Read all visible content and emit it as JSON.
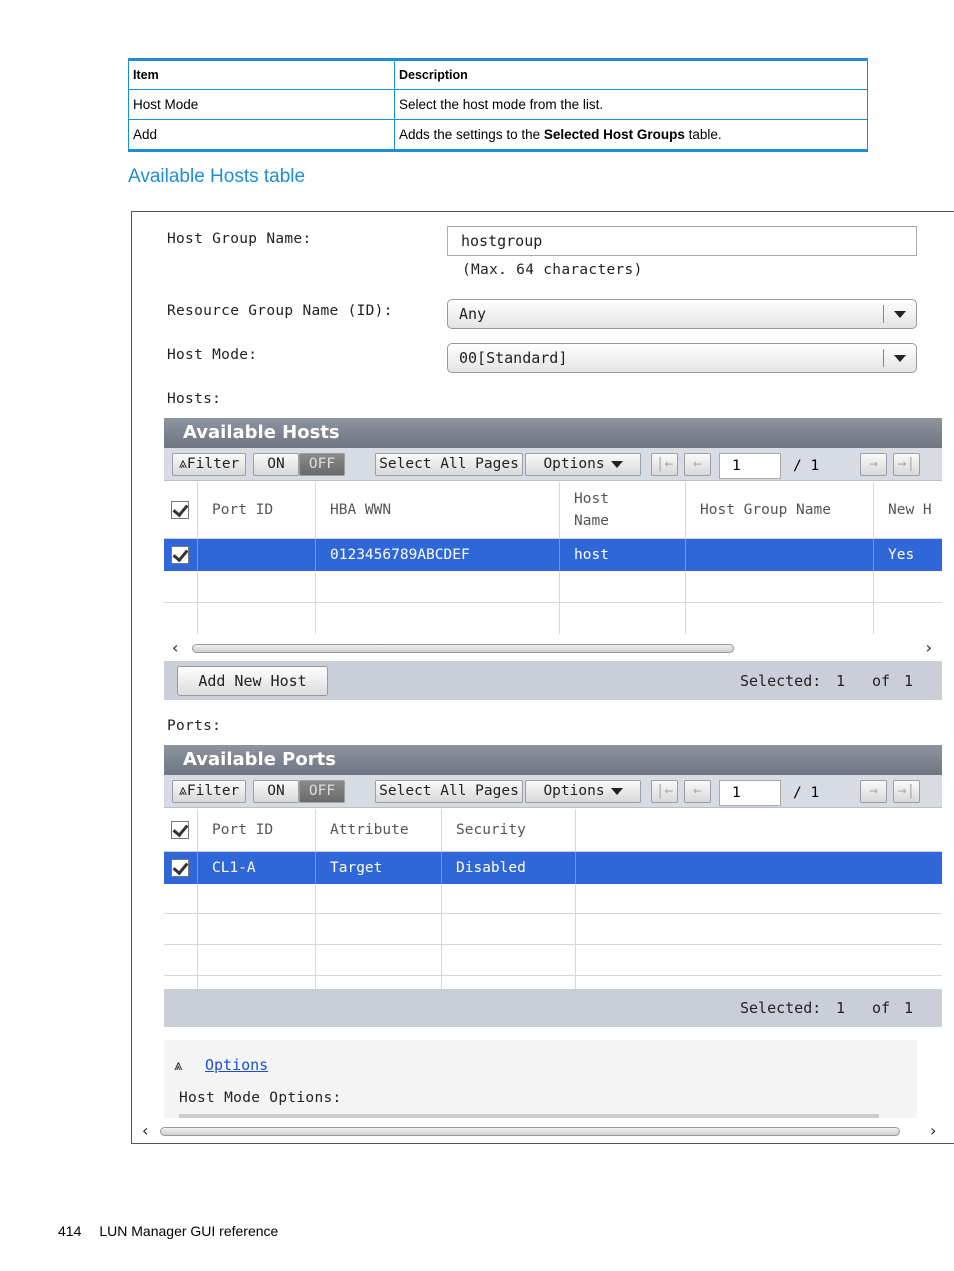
{
  "doc_table": {
    "headers": [
      "Item",
      "Description"
    ],
    "rows": [
      {
        "item": "Host Mode",
        "desc_pre": "Select the host mode from the list.",
        "desc_bold": "",
        "desc_post": ""
      },
      {
        "item": "Add",
        "desc_pre": "Adds the settings to the ",
        "desc_bold": "Selected Host Groups",
        "desc_post": " table."
      }
    ]
  },
  "section_heading": "Available Hosts table",
  "form": {
    "host_group_label": "Host Group Name:",
    "host_group_value": "hostgroup",
    "host_group_hint": "(Max. 64 characters)",
    "resource_group_label": "Resource Group Name (ID):",
    "resource_group_value": "Any",
    "host_mode_label": "Host Mode:",
    "host_mode_value": "00[Standard]",
    "hosts_label": "Hosts:",
    "ports_label": "Ports:"
  },
  "toolbar": {
    "filter": "⩓Filter",
    "on": "ON",
    "off": "OFF",
    "select_all": "Select All Pages",
    "options": "Options",
    "first": "|←",
    "prev": "←",
    "page": "1",
    "of_pages": "/ 1",
    "next": "→",
    "last": "→|"
  },
  "hosts_table": {
    "title": "Available Hosts",
    "columns": [
      "Port ID",
      "HBA WWN",
      "Host\nName",
      "Host Group Name",
      "New H"
    ],
    "col_host_name_1": "Host",
    "col_host_name_2": "Name",
    "selected_row": [
      "",
      "0123456789ABCDEF",
      "host",
      "",
      "Yes"
    ],
    "add_button": "Add New Host",
    "selected_label": "Selected:",
    "selected_count": "1",
    "of_label": "of",
    "total": "1"
  },
  "ports_table": {
    "title": "Available Ports",
    "columns": [
      "Port ID",
      "Attribute",
      "Security"
    ],
    "selected_row": [
      "CL1-A",
      "Target",
      "Disabled"
    ],
    "selected_label": "Selected:",
    "selected_count": "1",
    "of_label": "of",
    "total": "1"
  },
  "options": {
    "toggle_icon": "⩓",
    "link": "Options",
    "host_mode_options_label": "Host Mode Options:"
  },
  "footer": {
    "page_number": "414",
    "page_title": "LUN Manager GUI reference"
  }
}
